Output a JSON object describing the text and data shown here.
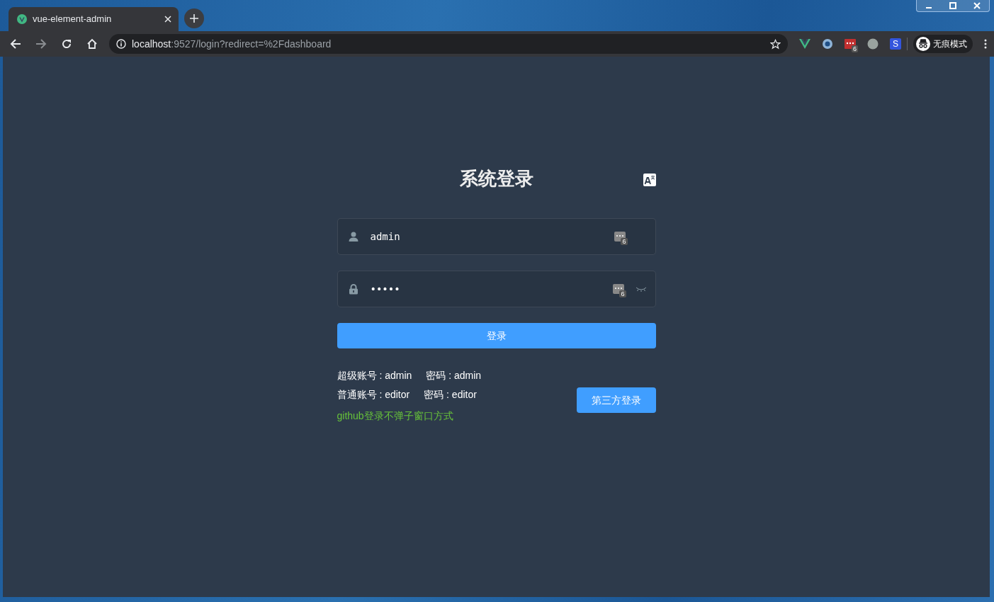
{
  "browser": {
    "tab": {
      "title": "vue-element-admin"
    },
    "url": {
      "host": "localhost",
      "rest": ":9527/login?redirect=%2Fdashboard"
    },
    "extensions": [
      {
        "kind": "vue"
      },
      {
        "kind": "ring"
      },
      {
        "kind": "dots",
        "badge": "6"
      },
      {
        "kind": "dot"
      },
      {
        "kind": "letter",
        "label": "S"
      }
    ],
    "profile": "无痕模式"
  },
  "login": {
    "title": "系统登录",
    "fields": [
      {
        "kind": "user",
        "value": "admin",
        "badge": "6"
      },
      {
        "kind": "password",
        "value": "•••••",
        "badge": "6"
      }
    ],
    "submit": "登录",
    "tips": [
      {
        "account": "超级账号 : admin",
        "password": "密码 : admin"
      },
      {
        "account": "普通账号 : editor",
        "password": "密码 : editor"
      }
    ],
    "github_hint": "github登录不弹子窗口方式",
    "third_party": "第三方登录"
  }
}
